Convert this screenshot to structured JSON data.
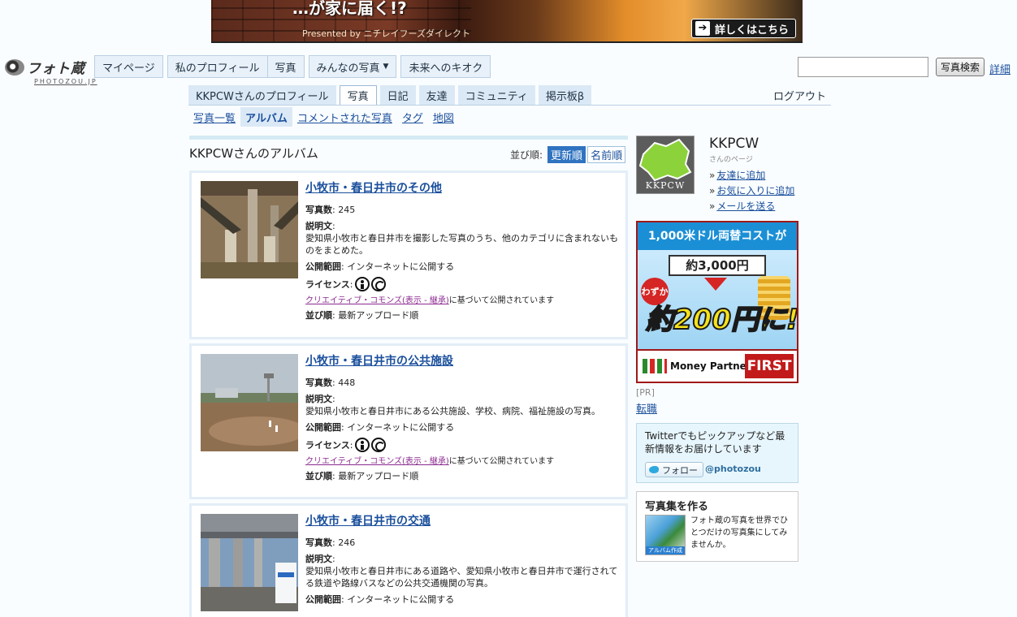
{
  "banner": {
    "headline": "…が家に届く!?",
    "presented": "Presented by ニチレイフーズダイレクト",
    "cta": "詳しくはこちら"
  },
  "logo": {
    "name": "フォト蔵",
    "sub": "PHOTOZOU.JP"
  },
  "global_nav": [
    {
      "label": "マイページ"
    },
    {
      "label": "私のプロフィール"
    },
    {
      "label": "写真"
    },
    {
      "label": "みんなの写真"
    },
    {
      "label": "未来へのキオク"
    }
  ],
  "search": {
    "button": "写真検索",
    "detail": "詳細",
    "value": ""
  },
  "user_tabs": [
    {
      "label": "KKPCWさんのプロフィール",
      "active": false
    },
    {
      "label": "写真",
      "active": true
    },
    {
      "label": "日記",
      "active": false
    },
    {
      "label": "友達",
      "active": false
    },
    {
      "label": "コミュニティ",
      "active": false
    },
    {
      "label": "掲示板β",
      "active": false
    }
  ],
  "logout": "ログアウト",
  "sub_nav": [
    {
      "label": "写真一覧",
      "active": false
    },
    {
      "label": "アルバム",
      "active": true
    },
    {
      "label": "コメントされた写真",
      "active": false
    },
    {
      "label": "タグ",
      "active": false
    },
    {
      "label": "地図",
      "active": false
    }
  ],
  "main": {
    "title": "KKPCWさんのアルバム",
    "sort_label": "並び順:",
    "sort_options": [
      {
        "label": "更新順",
        "active": true
      },
      {
        "label": "名前順",
        "active": false
      }
    ]
  },
  "field_labels": {
    "count": "写真数",
    "desc": "説明文",
    "scope": "公開範囲",
    "license": "ライセンス",
    "order": "並び順"
  },
  "albums": [
    {
      "title": "小牧市・春日井市のその他",
      "count": "245",
      "desc": "愛知県小牧市と春日井市を撮影した写真のうち、他のカテゴリに含まれないものをまとめた。",
      "scope": "インターネットに公開する",
      "cc_link": "クリエイティブ・コモンズ(表示 - 継承)",
      "cc_suffix": "に基づいて公開されています",
      "order": "最新アップロード順"
    },
    {
      "title": "小牧市・春日井市の公共施設",
      "count": "448",
      "desc": "愛知県小牧市と春日井市にある公共施設、学校、病院、福祉施設の写真。",
      "scope": "インターネットに公開する",
      "cc_link": "クリエイティブ・コモンズ(表示 - 継承)",
      "cc_suffix": "に基づいて公開されています",
      "order": "最新アップロード順"
    },
    {
      "title": "小牧市・春日井市の交通",
      "count": "246",
      "desc": "愛知県小牧市と春日井市にある道路や、愛知県小牧市と春日井市で運行されてる鉄道や路線バスなどの公共交通機関の写真。",
      "scope": "インターネットに公開する"
    }
  ],
  "profile": {
    "pic_label": "KKPCW",
    "name": "KKPCW",
    "sub": "さんのページ",
    "links": [
      "友達に追加",
      "お気に入りに追加",
      "メールを送る"
    ]
  },
  "ad": {
    "top": "1,000米ドル両替コストが",
    "mid": "約3,000円",
    "small": "わずか",
    "big": "約200円に!",
    "brand": "Money Partners",
    "first": "FIRST"
  },
  "pr": "[PR]",
  "pr_link": "転職",
  "twitter": {
    "text": "Twitterでもピックアップなど最新情報をお届けしています",
    "button": "フォロー",
    "handle": "@photozou"
  },
  "book": {
    "title": "写真集を作る",
    "img_label": "アルバム作成",
    "text": "フォト蔵の写真を世界でひとつだけの写真集にしてみませんか。"
  },
  "colors": {
    "accent": "#1a4f9c",
    "tab_bg": "#dbe9f6",
    "active_sort": "#2f73c0"
  }
}
